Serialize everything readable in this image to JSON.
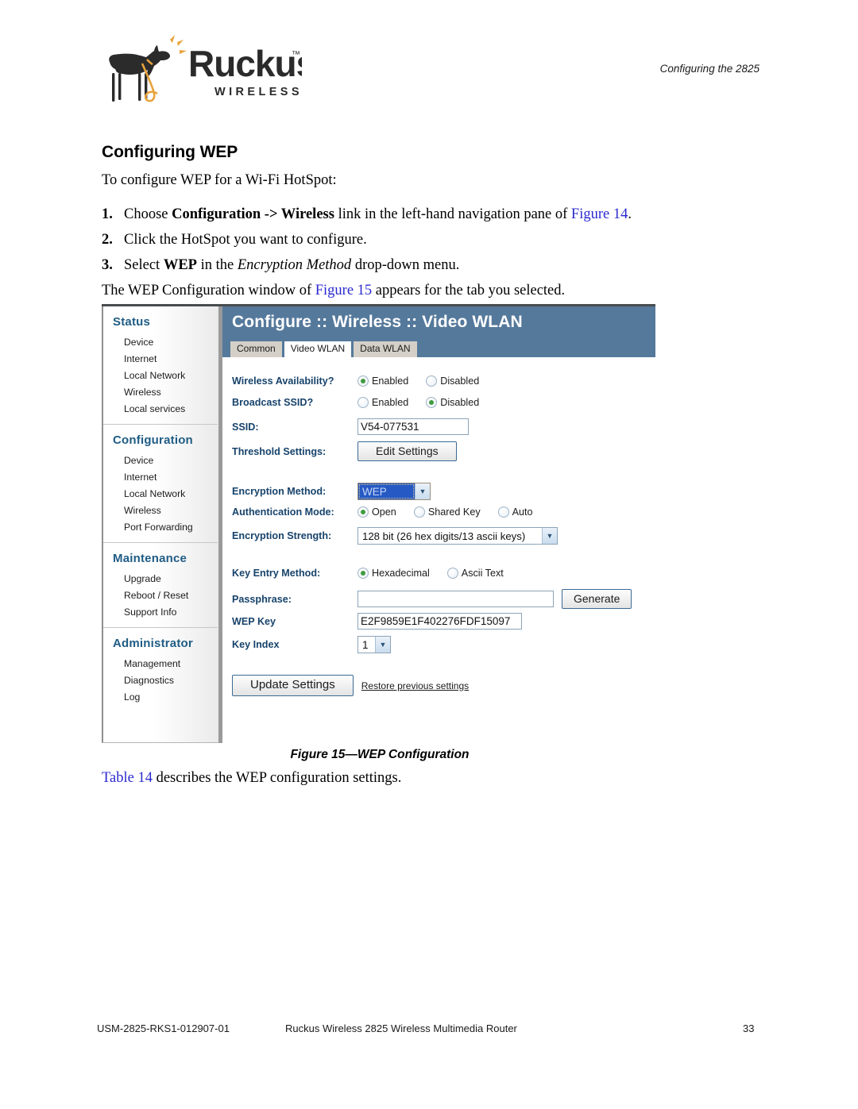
{
  "header": {
    "running_title": "Configuring the 2825",
    "logo_wordmark": "Ruckus",
    "logo_tm": "™",
    "logo_subtext": "WIRELESS"
  },
  "content": {
    "section_heading": "Configuring WEP",
    "intro": "To configure WEP for a Wi-Fi HotSpot:",
    "steps": [
      {
        "num": "1.",
        "parts": [
          {
            "text": "Choose ",
            "style": "normal"
          },
          {
            "text": "Configuration -> Wireless",
            "style": "bold"
          },
          {
            "text": " link in the left-hand navigation pane of ",
            "style": "normal"
          },
          {
            "text": "Figure 14",
            "style": "xref"
          },
          {
            "text": ".",
            "style": "normal"
          }
        ]
      },
      {
        "num": "2.",
        "parts": [
          {
            "text": "Click the HotSpot you want to configure.",
            "style": "normal"
          }
        ]
      },
      {
        "num": "3.",
        "parts": [
          {
            "text": "Select ",
            "style": "normal"
          },
          {
            "text": "WEP",
            "style": "bold"
          },
          {
            "text": " in the ",
            "style": "normal"
          },
          {
            "text": "Encryption Method",
            "style": "italic"
          },
          {
            "text": " drop-down menu.",
            "style": "normal"
          }
        ]
      }
    ],
    "after_steps": [
      {
        "text": "The WEP Configuration window of ",
        "style": "normal"
      },
      {
        "text": "Figure 15",
        "style": "xref"
      },
      {
        "text": " appears for the tab you selected.",
        "style": "normal"
      }
    ],
    "figure_caption_bold": "Figure 15",
    "figure_caption_rest": "—WEP Configuration",
    "table_ref": [
      {
        "text": "Table 14",
        "style": "xref"
      },
      {
        "text": " describes the WEP configuration settings.",
        "style": "normal"
      }
    ]
  },
  "router_ui": {
    "title": "Configure :: Wireless :: Video WLAN",
    "tabs": [
      {
        "label": "Common",
        "active": false
      },
      {
        "label": "Video WLAN",
        "active": true
      },
      {
        "label": "Data WLAN",
        "active": false
      }
    ],
    "sidebar": [
      {
        "title": "Status",
        "items": [
          "Device",
          "Internet",
          "Local Network",
          "Wireless",
          "Local services"
        ]
      },
      {
        "title": "Configuration",
        "items": [
          "Device",
          "Internet",
          "Local Network",
          "Wireless",
          "Port Forwarding"
        ]
      },
      {
        "title": "Maintenance",
        "items": [
          "Upgrade",
          "Reboot / Reset",
          "Support Info"
        ]
      },
      {
        "title": "Administrator",
        "items": [
          "Management",
          "Diagnostics",
          "Log"
        ]
      }
    ],
    "form": {
      "wireless_availability": {
        "label": "Wireless Availability?",
        "options": [
          "Enabled",
          "Disabled"
        ],
        "selected": "Enabled"
      },
      "broadcast_ssid": {
        "label": "Broadcast SSID?",
        "options": [
          "Enabled",
          "Disabled"
        ],
        "selected": "Disabled"
      },
      "ssid": {
        "label": "SSID:",
        "value": "V54-077531"
      },
      "threshold_settings": {
        "label": "Threshold Settings:",
        "button": "Edit Settings"
      },
      "encryption_method": {
        "label": "Encryption Method:",
        "value": "WEP"
      },
      "authentication_mode": {
        "label": "Authentication Mode:",
        "options": [
          "Open",
          "Shared Key",
          "Auto"
        ],
        "selected": "Open"
      },
      "encryption_strength": {
        "label": "Encryption Strength:",
        "value": "128 bit (26 hex digits/13 ascii keys)"
      },
      "key_entry_method": {
        "label": "Key Entry Method:",
        "options": [
          "Hexadecimal",
          "Ascii Text"
        ],
        "selected": "Hexadecimal"
      },
      "passphrase": {
        "label": "Passphrase:",
        "value": "",
        "button": "Generate"
      },
      "wep_key": {
        "label": "WEP Key",
        "value": "E2F9859E1F402276FDF15097"
      },
      "key_index": {
        "label": "Key Index",
        "value": "1"
      },
      "submit": {
        "button": "Update Settings",
        "restore_link": "Restore previous settings"
      }
    },
    "colors": {
      "titlebar": "#55799b",
      "nav_heading": "#1f5c84",
      "field_label": "#17436b",
      "radio_dot": "#3f9b3f",
      "select_highlight": "#2659c4"
    }
  },
  "footer": {
    "doc_id": "USM-2825-RKS1-012907-01",
    "product": "Ruckus Wireless 2825 Wireless Multimedia Router",
    "page_number": "33"
  }
}
